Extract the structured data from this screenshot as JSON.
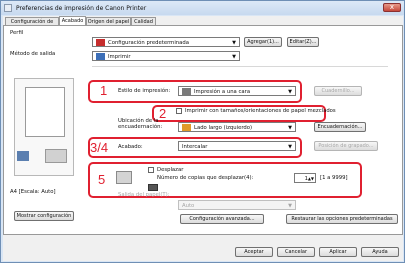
{
  "window": {
    "title": "Preferencias de impresión de Canon Printer",
    "close_label": "x"
  },
  "tabs": [
    "Configuración de página",
    "Acabado",
    "Origen del papel",
    "Calidad"
  ],
  "profile": {
    "label": "Perfil",
    "value": "Configuración predeterminada",
    "add_button": "Agregar(1)...",
    "edit_button": "Editar(Z)..."
  },
  "output_method": {
    "label": "Método de salida",
    "value": "Imprimir"
  },
  "print_style": {
    "label": "Estilo de impresión:",
    "value": "Impresión a una cara",
    "details_button": "Cuadernillo..."
  },
  "mixed_sizes": {
    "label": "Imprimir con tamaños/orientaciones de papel mezclados"
  },
  "binding": {
    "label": "Ubicación de la encuadernación:",
    "value": "Lado largo (izquierdo)",
    "button": "Encuadernación..."
  },
  "finishing": {
    "label": "Acabado:",
    "value": "Intercalar",
    "staple_button": "Posición de grapado..."
  },
  "offset": {
    "checkbox_label": "Desplazar",
    "copies_label": "Número de copias que desplazar(4):",
    "copies_value": "1",
    "range": "[1 a 9999]"
  },
  "paper_output": {
    "label": "Salida del papel(T):",
    "value": "Auto"
  },
  "preview_caption": "A4 [Escala: Auto]",
  "show_settings_button": "Mostrar configuración",
  "advanced_button": "Configuración avanzada...",
  "restore_defaults_button": "Restaurar las opciones predeterminadas",
  "dialog_buttons": {
    "ok": "Aceptar",
    "cancel": "Cancelar",
    "apply": "Aplicar",
    "help": "Ayuda"
  },
  "callouts": [
    "1",
    "2",
    "3/4",
    "5"
  ]
}
